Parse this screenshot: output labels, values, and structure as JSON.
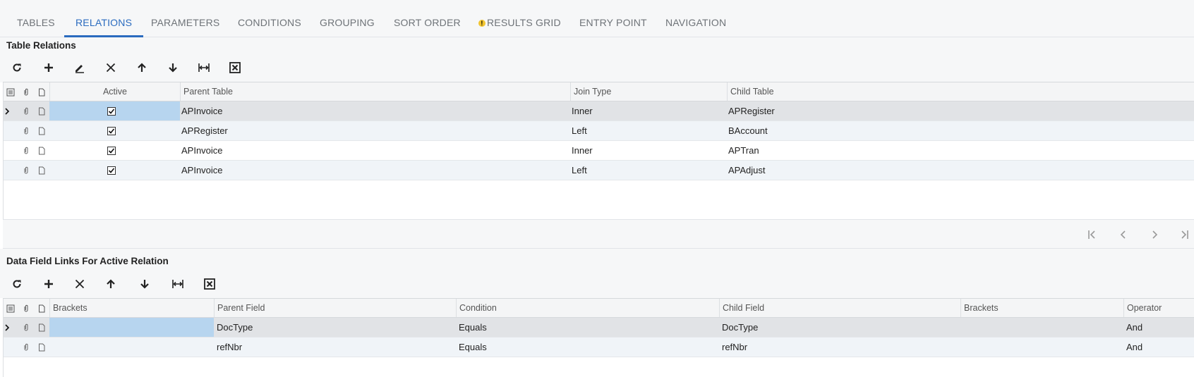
{
  "tabs": [
    {
      "label": "TABLES"
    },
    {
      "label": "RELATIONS",
      "active": true
    },
    {
      "label": "PARAMETERS"
    },
    {
      "label": "CONDITIONS"
    },
    {
      "label": "GROUPING"
    },
    {
      "label": "SORT ORDER"
    },
    {
      "label": "RESULTS GRID",
      "warning": true
    },
    {
      "label": "ENTRY POINT"
    },
    {
      "label": "NAVIGATION"
    }
  ],
  "relations": {
    "title": "Table Relations",
    "toolbar": [
      "refresh-icon",
      "add-icon",
      "edit-icon",
      "delete-icon",
      "move-up-icon",
      "move-down-icon",
      "fit-columns-icon",
      "export-excel-icon"
    ],
    "columns": {
      "active": "Active",
      "parent_table": "Parent Table",
      "join_type": "Join Type",
      "child_table": "Child Table"
    },
    "rows": [
      {
        "active": true,
        "parent_table": "APInvoice",
        "join_type": "Inner",
        "child_table": "APRegister"
      },
      {
        "active": true,
        "parent_table": "APRegister",
        "join_type": "Left",
        "child_table": "BAccount"
      },
      {
        "active": true,
        "parent_table": "APInvoice",
        "join_type": "Inner",
        "child_table": "APTran"
      },
      {
        "active": true,
        "parent_table": "APInvoice",
        "join_type": "Left",
        "child_table": "APAdjust"
      }
    ]
  },
  "pager": [
    "first-page-icon",
    "prev-page-icon",
    "next-page-icon",
    "last-page-icon"
  ],
  "links": {
    "title": "Data Field Links For Active Relation",
    "toolbar": [
      "refresh-icon",
      "add-icon",
      "delete-icon",
      "move-up-icon",
      "move-down-icon",
      "fit-columns-icon",
      "export-excel-icon"
    ],
    "columns": {
      "brackets": "Brackets",
      "parent_field": "Parent Field",
      "condition": "Condition",
      "child_field": "Child Field",
      "brackets2": "Brackets",
      "operator": "Operator"
    },
    "rows": [
      {
        "brackets": "",
        "parent_field": "DocType",
        "condition": "Equals",
        "child_field": "DocType",
        "brackets2": "",
        "operator": "And"
      },
      {
        "brackets": "",
        "parent_field": "refNbr",
        "condition": "Equals",
        "child_field": "refNbr",
        "brackets2": "",
        "operator": "And"
      }
    ]
  },
  "colors": {
    "accent": "#2a6bbf",
    "selected_cell": "#b7d5ef",
    "warning": "#f2c530"
  }
}
